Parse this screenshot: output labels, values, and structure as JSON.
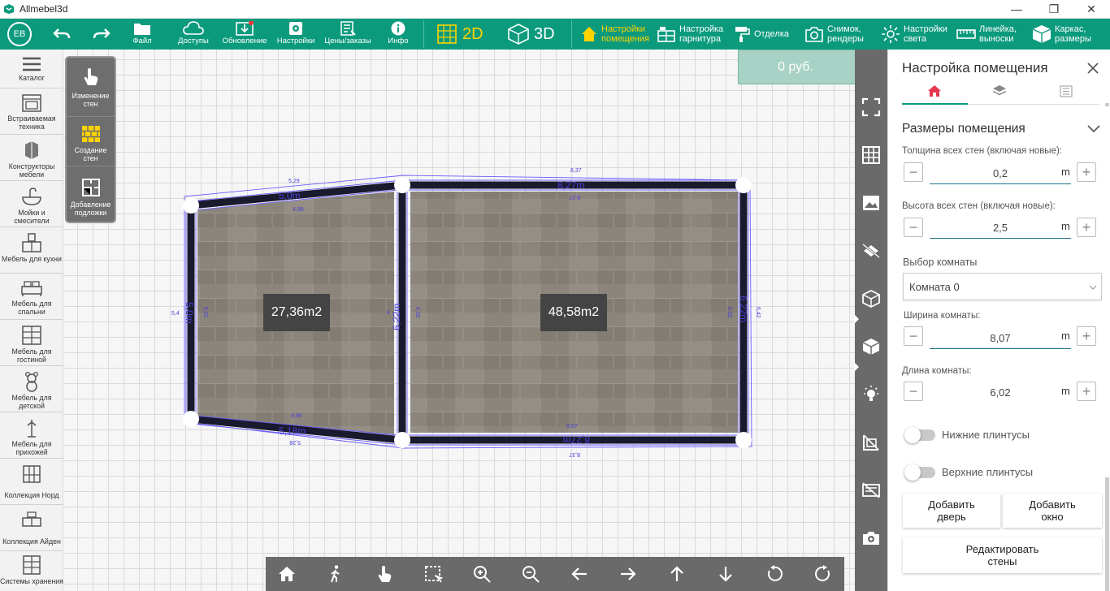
{
  "window": {
    "title": "Allmebel3d",
    "minimize": "—",
    "restore": "❐",
    "close": "✕"
  },
  "user": {
    "initials": "EB"
  },
  "toolbar": {
    "undo": "undo-icon",
    "redo": "redo-icon",
    "items": [
      {
        "label": "Файл",
        "icon": "folder-icon"
      },
      {
        "label": "Доступы",
        "icon": "cloud-icon"
      },
      {
        "label": "Обновление",
        "icon": "download-icon"
      },
      {
        "label": "Настройки",
        "icon": "gear-icon"
      },
      {
        "label": "Цены/заказы",
        "icon": "price-list-icon"
      },
      {
        "label": "Инфо",
        "icon": "info-icon"
      }
    ],
    "view2d": "2D",
    "view3d": "3D",
    "sections": [
      {
        "label": "Настройки помещения",
        "active": true
      },
      {
        "label": "Настройка гарнитура"
      },
      {
        "label": "Отделка"
      },
      {
        "label": "Снимок, рендеры"
      },
      {
        "label": "Настройки света"
      },
      {
        "label": "Линейка, выноски"
      },
      {
        "label": "Каркас, размеры"
      }
    ]
  },
  "catalog": [
    {
      "label": "Каталог"
    },
    {
      "label": "Встраиваемая техника"
    },
    {
      "label": "Конструкторы мебели"
    },
    {
      "label": "Мойки и смесители"
    },
    {
      "label": "Мебель для кухни"
    },
    {
      "label": "Мебель для спальни"
    },
    {
      "label": "Мебель для гостиной"
    },
    {
      "label": "Мебель для детской"
    },
    {
      "label": "Мебель для прихожей"
    },
    {
      "label": "Коллекция Норд"
    },
    {
      "label": "Коллекция Айден"
    },
    {
      "label": "Системы хранения"
    }
  ],
  "wall_tools": [
    {
      "label": "Изменение стен"
    },
    {
      "label": "Создание стен"
    },
    {
      "label": "Добавление подложки"
    }
  ],
  "price": {
    "value": "0 руб."
  },
  "plan": {
    "room1_area": "27,36m2",
    "room2_area": "48,58m2",
    "dims": {
      "top_left_outer": "5,29",
      "top_left_wall": "5,0m",
      "top_left_inner": "4,98",
      "left_outer": "5,4",
      "left_wall": "5,0m",
      "left_inner": "5,01",
      "mid_outer": "4",
      "mid_wall": "6,22m",
      "mid_inner": "6,02",
      "bottom_left_inner": "4,96",
      "bottom_left_wall": "5,18m",
      "bottom_left_outer": "5,28",
      "top_right_outer": "8,37",
      "top_right_wall": "8,27m",
      "top_right_inner": "8,07",
      "right_inner": "6,02",
      "right_wall": "6,22m",
      "right_outer": "6,42",
      "bottom_right_inner": "8,07",
      "bottom_right_wall": "8,27m",
      "bottom_right_outer": "8,37"
    }
  },
  "panel": {
    "title": "Настройка помещения",
    "tabs": [
      "home-icon",
      "layers-icon",
      "list-icon"
    ],
    "section_title": "Размеры помещения",
    "wall_thickness": {
      "label": "Толщина всех стен (включая новые):",
      "value": "0,2",
      "unit": "m"
    },
    "wall_height": {
      "label": "Высота всех стен (включая новые):",
      "value": "2,5",
      "unit": "m"
    },
    "room_select": {
      "label": "Выбор комнаты",
      "value": "Комната 0"
    },
    "room_width": {
      "label": "Ширина комнаты:",
      "value": "8,07",
      "unit": "m"
    },
    "room_length": {
      "label": "Длина комнаты:",
      "value": "6,02",
      "unit": "m"
    },
    "lower_baseboards": "Нижние плинтусы",
    "upper_baseboards": "Верхние плинтусы",
    "add_door": "Добавить дверь",
    "add_window": "Добавить окно",
    "edit_walls": "Редактировать стены"
  },
  "bottom_tools": [
    "home-icon",
    "walk-icon",
    "hand-pointer-icon",
    "select-area-icon",
    "zoom-in-icon",
    "zoom-out-icon",
    "arrow-left-icon",
    "arrow-right-icon",
    "arrow-up-icon",
    "arrow-down-icon",
    "rotate-left-icon",
    "rotate-right-icon"
  ],
  "right_tools": [
    "fullscreen-icon",
    "grid-icon",
    "image-icon",
    "hide-objects-icon",
    "box-wireframe-icon",
    "cube-icon",
    "light-bulb-icon",
    "hide-walls-icon",
    "hide-sizes-icon",
    "camera-icon"
  ],
  "colors": {
    "accent": "#0c9a7d",
    "active": "#ffd400",
    "wall": "#1a1a2e",
    "outline": "#6b5cff"
  }
}
